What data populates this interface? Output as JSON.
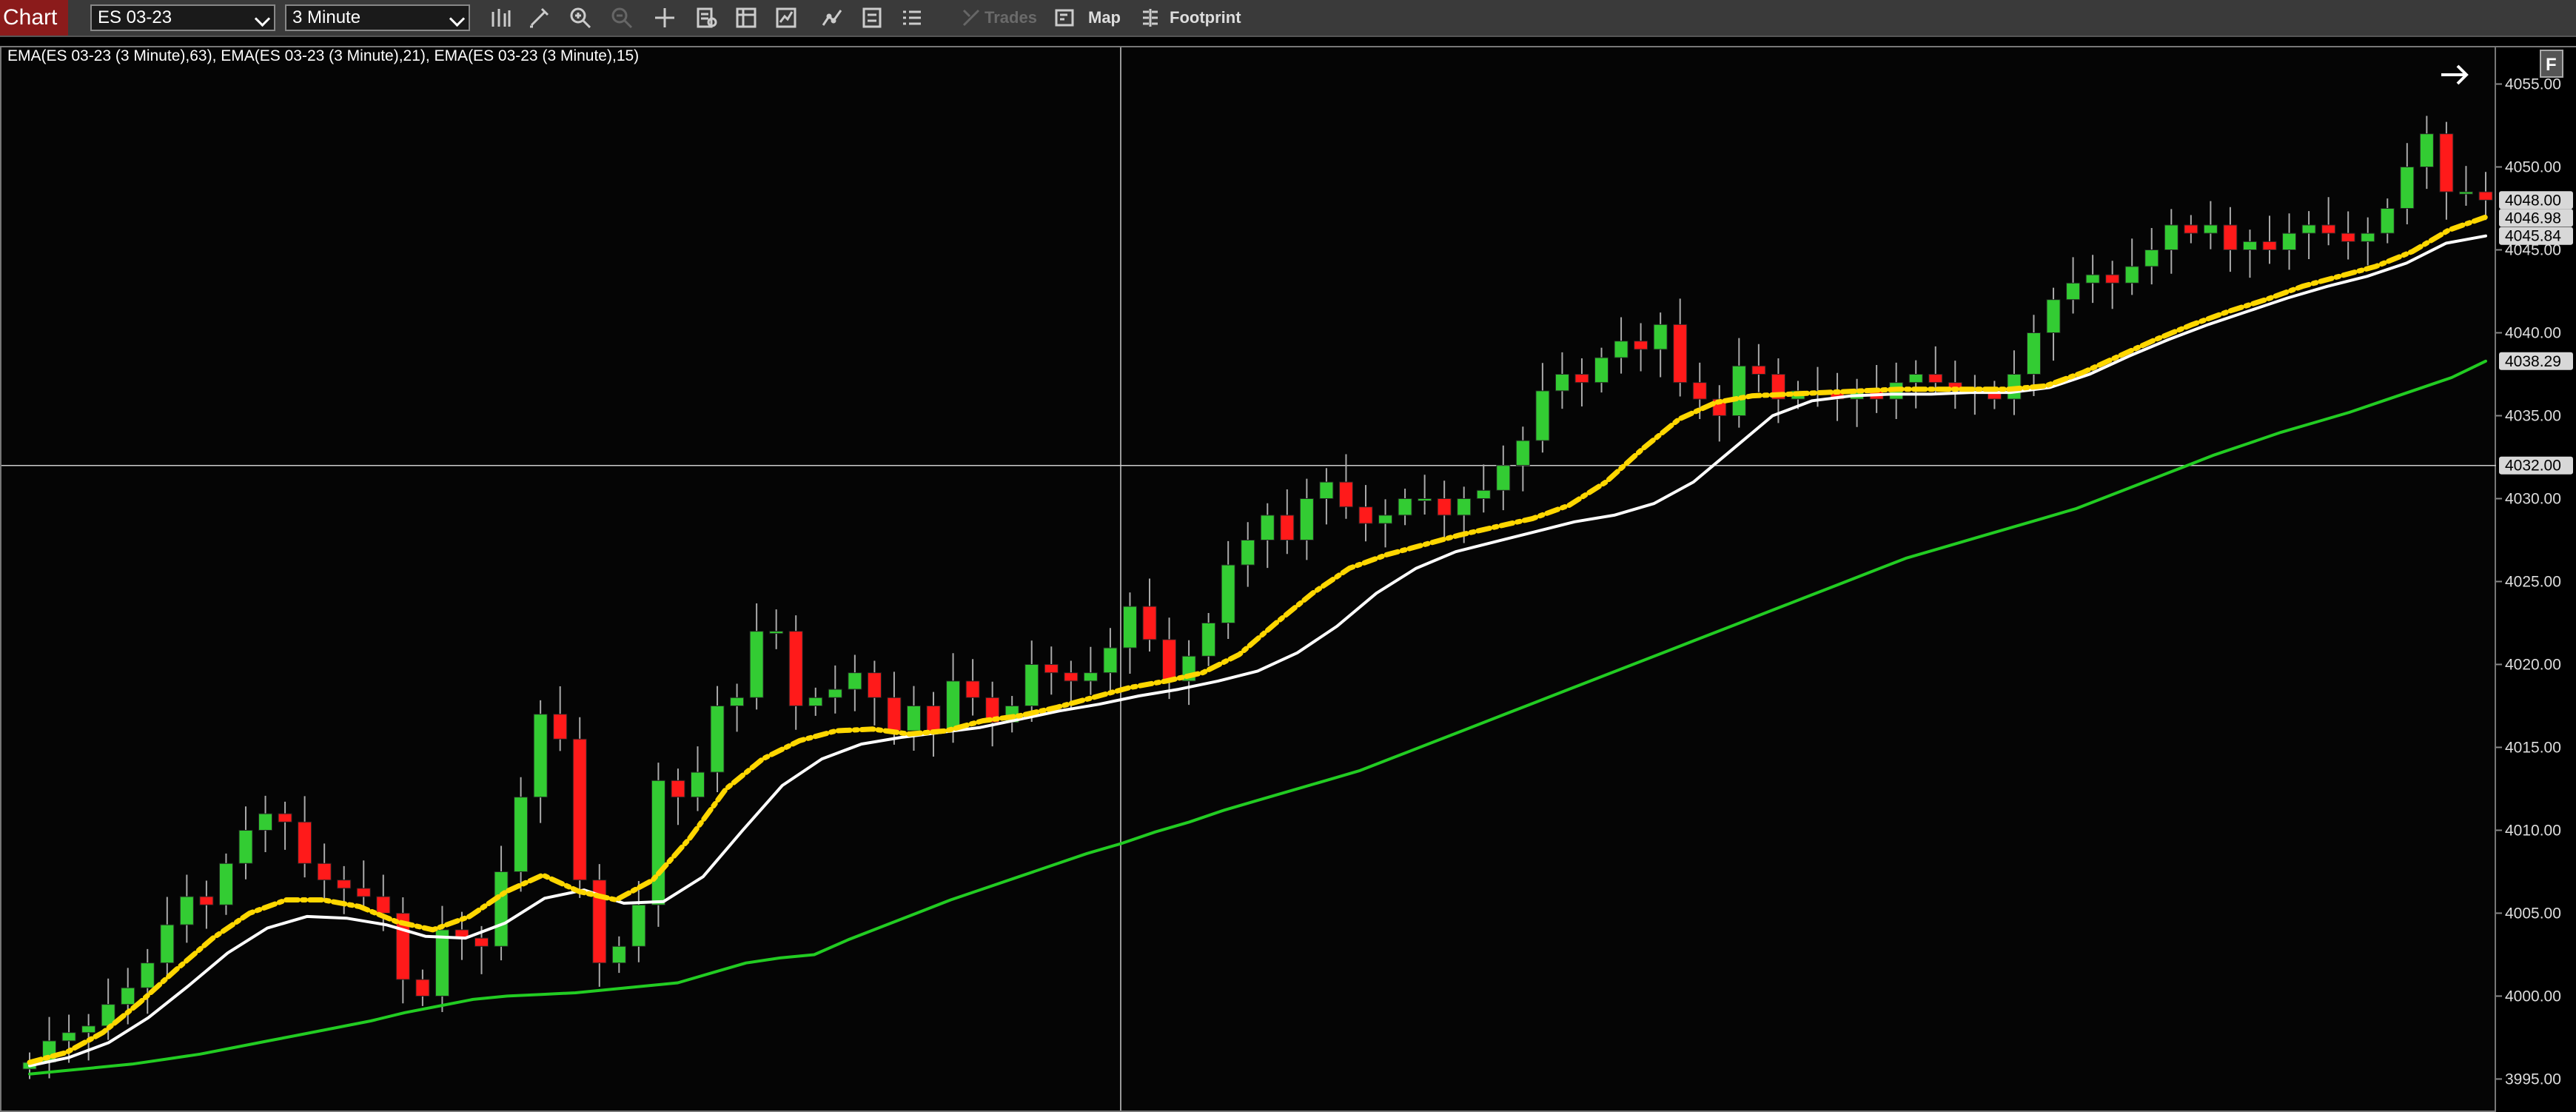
{
  "toolbar": {
    "chart_tab": "Chart",
    "instrument": "ES 03-23",
    "interval": "3 Minute",
    "icons": [
      "bar-type-icon",
      "draw-pencil-icon",
      "zoom-in-icon",
      "zoom-out-icon",
      "crosshair-icon",
      "data-box-icon",
      "indicators-icon",
      "strategies-icon",
      "chart-trader-icon",
      "properties-icon",
      "list-icon"
    ],
    "trades_label": "Trades",
    "map_label": "Map",
    "footprint_label": "Footprint"
  },
  "chart": {
    "indicator_label": "EMA(ES 03-23 (3 Minute),63), EMA(ES 03-23 (3 Minute),21), EMA(ES 03-23 (3 Minute),15)",
    "colors": {
      "up": "#33cc33",
      "down": "#ff1a1a",
      "ema63": "#22cc22",
      "ema21": "#ffd700",
      "ema15": "#ffffff",
      "crosshair": "#cccccc"
    }
  },
  "chart_data": {
    "type": "candlestick",
    "y_ticks": [
      "3995.00",
      "4000.00",
      "4005.00",
      "4010.00",
      "4015.00",
      "4020.00",
      "4025.00",
      "4030.00",
      "4035.00",
      "4040.00",
      "4045.00",
      "4050.00",
      "4055.00"
    ],
    "ylim": [
      3993.1,
      4057.3
    ],
    "price_labels": [
      {
        "text": "4048.00",
        "value": 4048.0
      },
      {
        "text": "4046.98",
        "value": 4046.98
      },
      {
        "text": "4045.84",
        "value": 4045.84
      },
      {
        "text": "4038.29",
        "value": 4038.29
      },
      {
        "text": "4032.00",
        "value": 4032.0
      }
    ],
    "crosshair_price": 4032.0,
    "close_path": [
      3996.0,
      3997.3,
      3997.8,
      3998.2,
      3999.5,
      4000.5,
      4002.0,
      4004.3,
      4006.0,
      4005.5,
      4008.0,
      4010.0,
      4011.0,
      4010.5,
      4008.0,
      4007.0,
      4006.5,
      4006.0,
      4005.0,
      4001.0,
      4000.0,
      4004.0,
      4003.5,
      4003.0,
      4007.5,
      4012.0,
      4017.0,
      4015.5,
      4007.0,
      4002.0,
      4003.0,
      4005.5,
      4013.0,
      4012.0,
      4013.5,
      4017.5,
      4018.0,
      4022.0,
      4022.0,
      4017.5,
      4018.0,
      4018.5,
      4019.5,
      4018.0,
      4016.0,
      4017.5,
      4016.0,
      4019.0,
      4018.0,
      4016.5,
      4017.5,
      4020.0,
      4019.5,
      4019.0,
      4019.5,
      4021.0,
      4023.5,
      4021.5,
      4019.0,
      4020.5,
      4022.5,
      4026.0,
      4027.5,
      4029.0,
      4027.5,
      4030.0,
      4031.0,
      4029.5,
      4028.5,
      4029.0,
      4030.0,
      4030.0,
      4029.0,
      4030.0,
      4030.5,
      4032.0,
      4033.5,
      4036.5,
      4037.5,
      4037.0,
      4038.5,
      4039.5,
      4039.0,
      4040.5,
      4037.0,
      4036.0,
      4035.0,
      4038.0,
      4037.5,
      4036.0,
      4036.5,
      4036.5,
      4036.0,
      4036.5,
      4036.0,
      4037.0,
      4037.5,
      4037.0,
      4036.5,
      4036.5,
      4036.0,
      4037.5,
      4040.0,
      4042.0,
      4043.0,
      4043.5,
      4043.0,
      4044.0,
      4045.0,
      4046.5,
      4046.0,
      4046.5,
      4045.0,
      4045.5,
      4045.0,
      4046.0,
      4046.5,
      4046.0,
      4045.5,
      4046.0,
      4047.5,
      4050.0,
      4052.0,
      4048.5,
      4048.5,
      4048.0
    ],
    "ema63": [
      3995.3,
      3995.5,
      3995.7,
      3995.9,
      3996.2,
      3996.5,
      3996.9,
      3997.3,
      3997.7,
      3998.1,
      3998.5,
      3999.0,
      3999.4,
      3999.8,
      4000.0,
      4000.1,
      4000.2,
      4000.4,
      4000.6,
      4000.8,
      4001.4,
      4002.0,
      4002.3,
      4002.5,
      4003.4,
      4004.2,
      4005.0,
      4005.8,
      4006.5,
      4007.2,
      4007.9,
      4008.6,
      4009.2,
      4009.9,
      4010.5,
      4011.2,
      4011.8,
      4012.4,
      4013.0,
      4013.6,
      4014.4,
      4015.2,
      4016.0,
      4016.8,
      4017.6,
      4018.4,
      4019.2,
      4020.0,
      4020.8,
      4021.6,
      4022.4,
      4023.2,
      4024.0,
      4024.8,
      4025.6,
      4026.4,
      4027.0,
      4027.6,
      4028.2,
      4028.8,
      4029.4,
      4030.2,
      4031.0,
      4031.8,
      4032.6,
      4033.3,
      4034.0,
      4034.6,
      4035.2,
      4035.9,
      4036.6,
      4037.3,
      4038.29
    ],
    "ema21": [
      3996.0,
      3996.6,
      3997.8,
      3999.6,
      4001.6,
      4003.5,
      4005.0,
      4005.8,
      4005.8,
      4005.4,
      4004.5,
      4004.0,
      4004.8,
      4006.3,
      4007.3,
      4006.3,
      4005.8,
      4007.0,
      4009.5,
      4012.5,
      4014.3,
      4015.4,
      4016.0,
      4016.1,
      4015.8,
      4016.0,
      4016.6,
      4016.9,
      4017.4,
      4018.0,
      4018.6,
      4019.0,
      4019.5,
      4020.6,
      4022.5,
      4024.3,
      4025.8,
      4026.6,
      4027.2,
      4027.8,
      4028.3,
      4028.8,
      4029.6,
      4031.0,
      4033.0,
      4034.8,
      4035.8,
      4036.2,
      4036.3,
      4036.4,
      4036.5,
      4036.6,
      4036.6,
      4036.6,
      4036.6,
      4036.8,
      4037.6,
      4038.6,
      4039.6,
      4040.5,
      4041.3,
      4042.0,
      4042.8,
      4043.4,
      4044.0,
      4044.9,
      4046.2,
      4046.98
    ],
    "ema15": [
      3995.8,
      3996.3,
      3997.2,
      3998.7,
      4000.6,
      4002.6,
      4004.1,
      4004.8,
      4004.7,
      4004.3,
      4003.6,
      4003.5,
      4004.4,
      4005.9,
      4006.4,
      4005.6,
      4005.7,
      4007.2,
      4010.0,
      4012.7,
      4014.3,
      4015.2,
      4015.6,
      4015.9,
      4016.2,
      4016.7,
      4017.2,
      4017.6,
      4018.1,
      4018.5,
      4019.0,
      4019.6,
      4020.7,
      4022.3,
      4024.3,
      4025.8,
      4026.8,
      4027.4,
      4028.0,
      4028.6,
      4029.0,
      4029.7,
      4031.0,
      4033.0,
      4035.0,
      4035.9,
      4036.2,
      4036.3,
      4036.3,
      4036.4,
      4036.4,
      4036.7,
      4037.5,
      4038.6,
      4039.6,
      4040.5,
      4041.3,
      4042.1,
      4042.8,
      4043.4,
      4044.2,
      4045.4,
      4045.84
    ]
  }
}
